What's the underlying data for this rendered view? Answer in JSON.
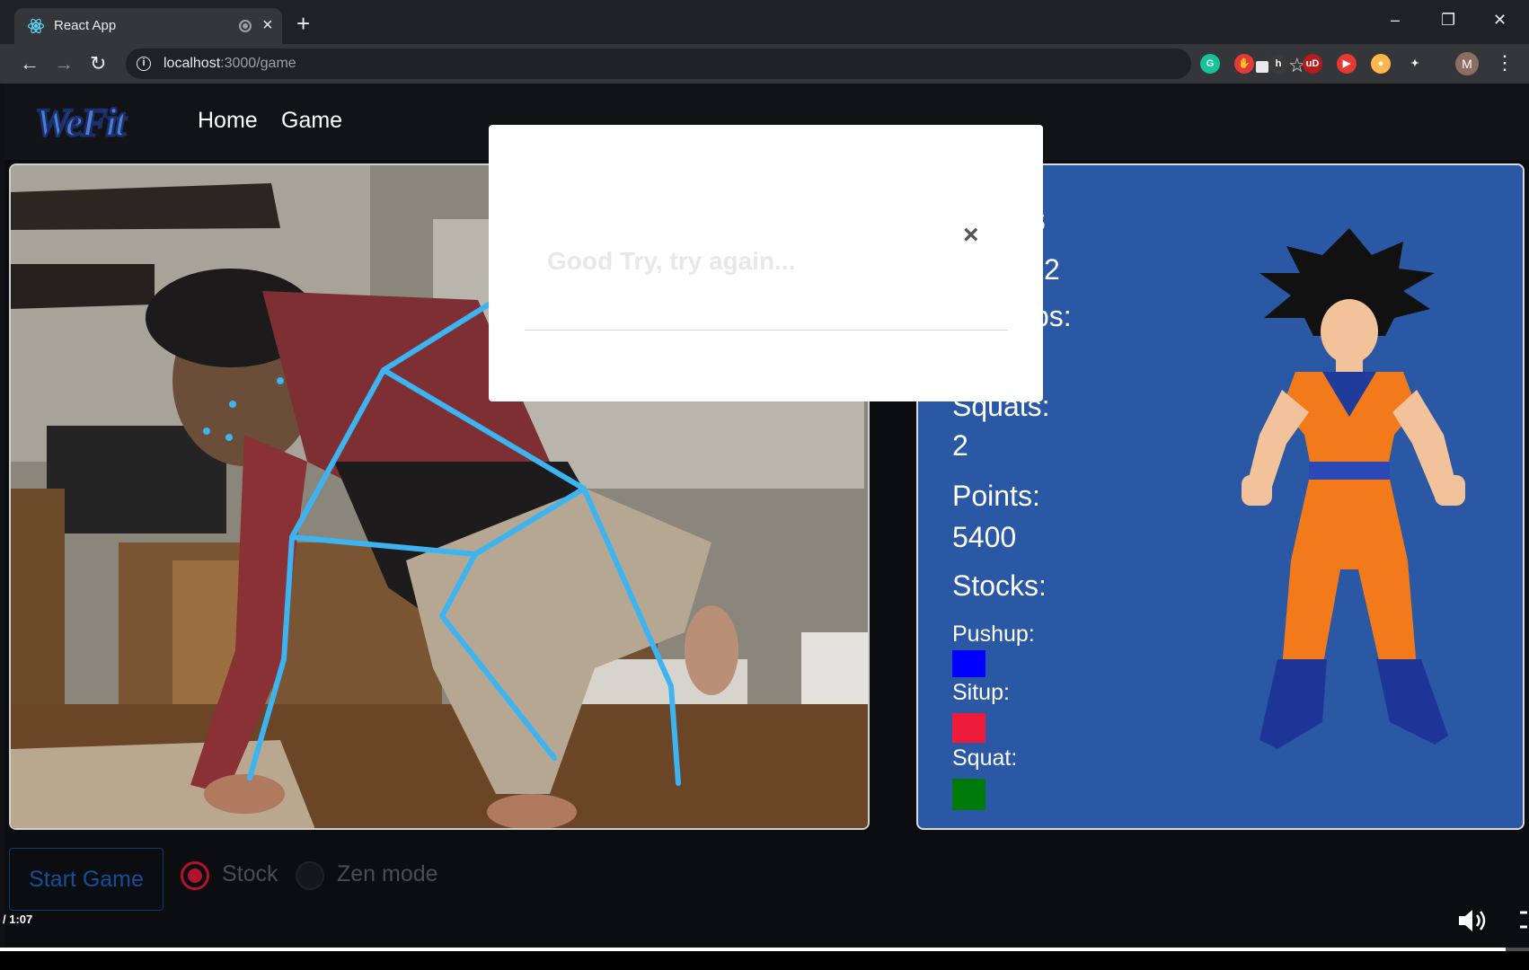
{
  "browser": {
    "tab_title": "React App",
    "tab_close": "×",
    "new_tab": "+",
    "url_host": "localhost",
    "url_path": ":3000/game",
    "avatar_initial": "M",
    "window_controls": {
      "minimize": "–",
      "restore": "❐",
      "close": "✕"
    },
    "extensions": [
      {
        "name": "grammarly-icon",
        "label": "G",
        "color": "#15c39a"
      },
      {
        "name": "stop-ext-icon",
        "label": "✋",
        "color": "#e53935"
      },
      {
        "name": "h-ext-icon",
        "label": "h",
        "color": "#3a3a3a"
      },
      {
        "name": "ublock-icon",
        "label": "uD",
        "color": "#b71c1c"
      },
      {
        "name": "video-ext-icon",
        "label": "▶",
        "color": "#e53935"
      },
      {
        "name": "orange-ext-icon",
        "label": "●",
        "color": "#ffb74d"
      },
      {
        "name": "puzzle-icon",
        "label": "✦",
        "color": "#35363a"
      }
    ]
  },
  "navbar": {
    "logo_text": "WeFit",
    "links": [
      "Home",
      "Game"
    ]
  },
  "stats": {
    "heading_fragment": "s",
    "row1_value": "2",
    "row2_fragment": "ps:",
    "squats_label": "Squats:",
    "squats_value": "2",
    "points_label": "Points:",
    "points_value": "5400",
    "stocks_label": "Stocks:",
    "stocks": [
      {
        "label": "Pushup:",
        "color": "#0000ff"
      },
      {
        "label": "Situp:",
        "color": "#ed1c3a"
      },
      {
        "label": "Squat:",
        "color": "#007a0a"
      }
    ]
  },
  "controls": {
    "start_label": "Start Game",
    "modes": [
      {
        "label": "Stock",
        "selected": true
      },
      {
        "label": "Zen mode",
        "selected": false
      }
    ]
  },
  "modal": {
    "message": "Good Try, try again...",
    "close": "×"
  },
  "player": {
    "time": "/ 1:07",
    "progress_fraction": 0.985
  },
  "colors": {
    "skeleton": "#3db4f2",
    "stats_bg": "#2b58a5",
    "accent_red": "#b0132b"
  }
}
